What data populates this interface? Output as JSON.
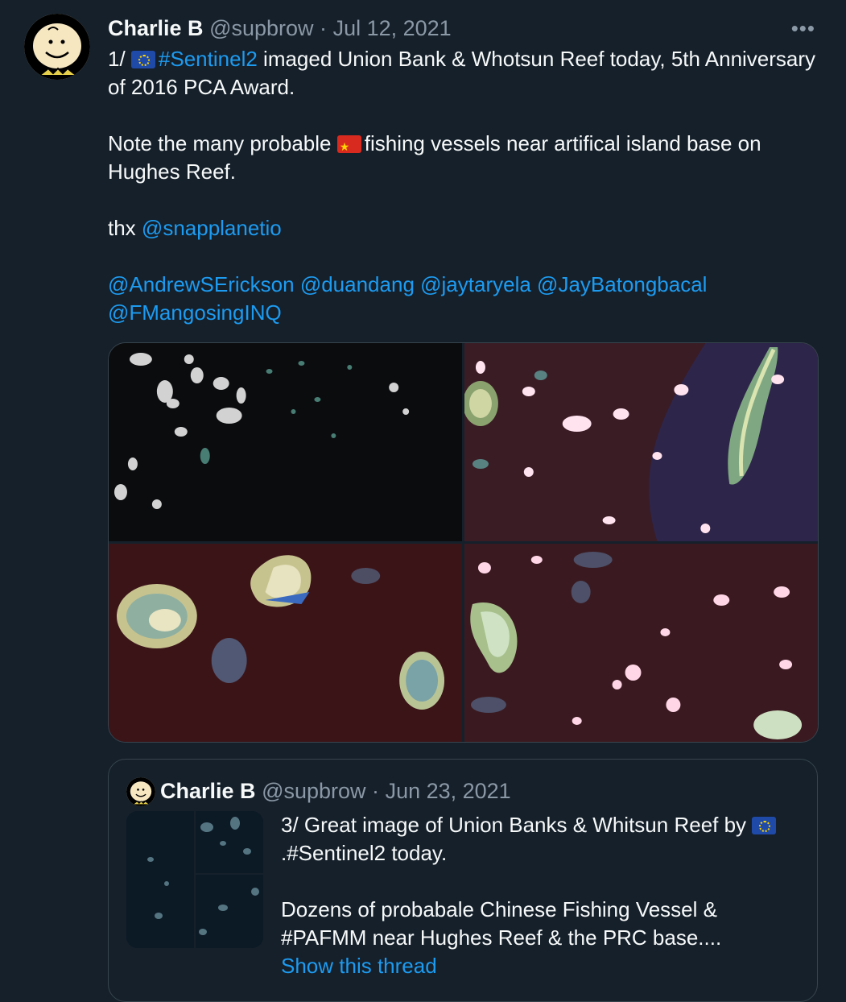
{
  "tweet": {
    "author_name": "Charlie B",
    "handle": "@supbrow",
    "separator": "·",
    "date": "Jul 12, 2021",
    "more_label": "•••",
    "line1_prefix": "1/ ",
    "hashtag_sentinel": "#Sentinel2",
    "line1_rest": " imaged Union Bank & Whotsun Reef today, 5th Anniversary of 2016 PCA Award.",
    "line2_prefix": "Note the many probable ",
    "line2_rest": "fishing vessels near artifical island base on Hughes Reef.",
    "thx_prefix": "thx ",
    "mention_snap": "@snapplanetio",
    "mentions": [
      "@AndrewSErickson",
      "@duandang",
      "@jaytaryela",
      "@JayBatongbacal",
      "@FMangosingINQ"
    ]
  },
  "quote": {
    "author_name": "Charlie B",
    "handle": "@supbrow",
    "separator": "·",
    "date": "Jun 23, 2021",
    "line1_prefix": "3/ Great image of Union Banks & Whitsun Reef by ",
    "line1_rest": ".#Sentinel2 today.",
    "line2": "Dozens of probabale Chinese Fishing Vessel & #PAFMM near Hughes Reef & the PRC base....",
    "show_thread": "Show this thread"
  },
  "colors": {
    "background": "#15202b",
    "link": "#1d9bf0",
    "muted": "#8b98a5",
    "border": "#38444d"
  },
  "icons": [
    "avatar-charlie-brown",
    "eu-flag-icon",
    "china-flag-icon",
    "more-icon"
  ]
}
